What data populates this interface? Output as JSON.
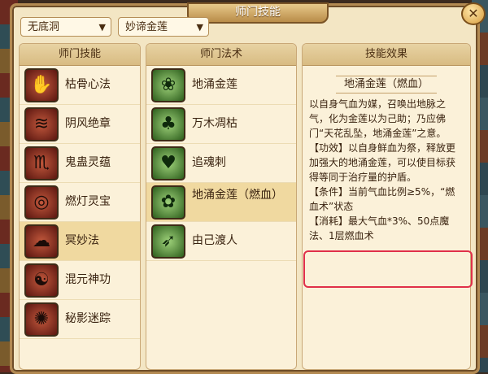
{
  "window": {
    "title": "师门技能",
    "close_icon": "close-icon"
  },
  "filters": {
    "school": "无底洞",
    "skill_tree": "妙谛金莲"
  },
  "columns": {
    "school_skills": {
      "header": "师门技能",
      "items": [
        {
          "label": "枯骨心法",
          "icon": "skull-hand-icon"
        },
        {
          "label": "阴风绝章",
          "icon": "wind-scroll-icon"
        },
        {
          "label": "鬼蛊灵蕴",
          "icon": "scorpion-icon"
        },
        {
          "label": "燃灯灵宝",
          "icon": "lantern-icon"
        },
        {
          "label": "冥妙法",
          "icon": "cloud-icon",
          "selected": true
        },
        {
          "label": "混元神功",
          "icon": "dragon-icon"
        },
        {
          "label": "秘影迷踪",
          "icon": "swirl-icon"
        }
      ]
    },
    "spells": {
      "header": "师门法术",
      "items": [
        {
          "label": "地涌金莲",
          "icon": "lotus-icon"
        },
        {
          "label": "万木凋枯",
          "icon": "tree-icon"
        },
        {
          "label": "追魂刺",
          "icon": "heart-arrow-icon"
        },
        {
          "label": "地涌金莲（燃血）",
          "icon": "lotus-flame-icon",
          "selected": true
        },
        {
          "label": "由己渡人",
          "icon": "feather-icon"
        }
      ]
    },
    "effect": {
      "header": "技能效果",
      "name": "地涌金莲（燃血）",
      "paragraphs": [
        "以自身气血为媒，召唤出地脉之气，化为金莲以为己助；乃应佛门“天花乱坠，地涌金莲”之意。",
        "【功效】以自身鲜血为祭，释放更加强大的地涌金莲，可以使目标获得等同于治疗量的护盾。",
        "【条件】当前气血比例≥5%，“燃血术”状态",
        "【消耗】最大气血*3%、50点魔法、1层燃血术"
      ]
    }
  },
  "colors": {
    "highlight_border": "#e0304a",
    "panel_bg": "#fbf1d9"
  }
}
